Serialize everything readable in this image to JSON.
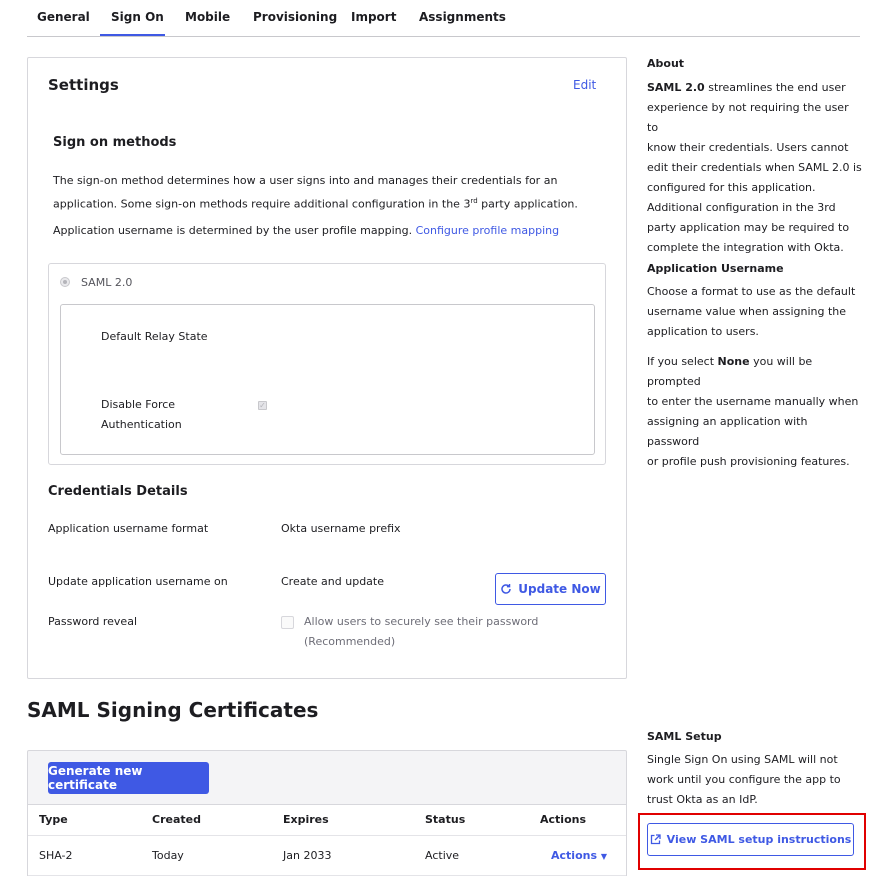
{
  "tabs": [
    {
      "label": "General"
    },
    {
      "label": "Sign On"
    },
    {
      "label": "Mobile"
    },
    {
      "label": "Provisioning"
    },
    {
      "label": "Import"
    },
    {
      "label": "Assignments"
    }
  ],
  "active_tab": "Sign On",
  "settings": {
    "title": "Settings",
    "edit_label": "Edit",
    "sign_on_methods_title": "Sign on methods",
    "description_line1": "The sign-on method determines how a user signs into and manages their credentials for an",
    "description_line2_a": "application. Some sign-on methods require additional configuration in the 3",
    "description_sup": "rd",
    "description_line2_b": " party application.",
    "username_mapping_text": "Application username is determined by the user profile mapping.",
    "configure_profile_link": "Configure profile mapping",
    "saml_option_label": "SAML 2.0",
    "default_relay_state_label": "Default Relay State",
    "disable_force_auth_line1": "Disable Force",
    "disable_force_auth_line2": "Authentication",
    "disable_force_auth_checked": true
  },
  "credentials": {
    "title": "Credentials Details",
    "username_format_label": "Application username format",
    "username_format_value": "Okta username prefix",
    "update_on_label": "Update application username on",
    "update_on_value": "Create and update",
    "update_now_label": "Update Now",
    "password_reveal_label": "Password reveal",
    "password_reveal_text_line1": "Allow users to securely see their password",
    "password_reveal_text_line2": "(Recommended)",
    "password_reveal_checked": false
  },
  "certificates": {
    "title": "SAML Signing Certificates",
    "generate_label": "Generate new certificate",
    "columns": [
      "Type",
      "Created",
      "Expires",
      "Status",
      "Actions"
    ],
    "rows": [
      {
        "type": "SHA-2",
        "created": "Today",
        "expires": "Jan 2033",
        "status": "Active",
        "actions": "Actions"
      }
    ]
  },
  "sidebar": {
    "about_title": "About",
    "about_bold": "SAML 2.0",
    "about_lines": [
      " streamlines the end user",
      "experience by not requiring the user to",
      "know their credentials. Users cannot",
      "edit their credentials when SAML 2.0 is",
      "configured for this application.",
      "Additional configuration in the 3rd",
      "party application may be required to",
      "complete the integration with Okta."
    ],
    "app_username_title": "Application Username",
    "app_username_lines": [
      "Choose a format to use as the default",
      "username value when assigning the",
      "application to users."
    ],
    "none_prefix": "If you select ",
    "none_bold": "None",
    "none_line1_suffix": " you will be prompted",
    "none_lines": [
      "to enter the username manually when",
      "assigning an application with password",
      "or profile push provisioning features."
    ],
    "saml_setup_title": "SAML Setup",
    "saml_setup_lines": [
      "Single Sign On using SAML will not",
      "work until you configure the app to",
      "trust Okta as an IdP."
    ],
    "saml_setup_button": "View SAML setup instructions"
  },
  "colors": {
    "accent": "#3f59e4",
    "highlight": "#e00000"
  }
}
